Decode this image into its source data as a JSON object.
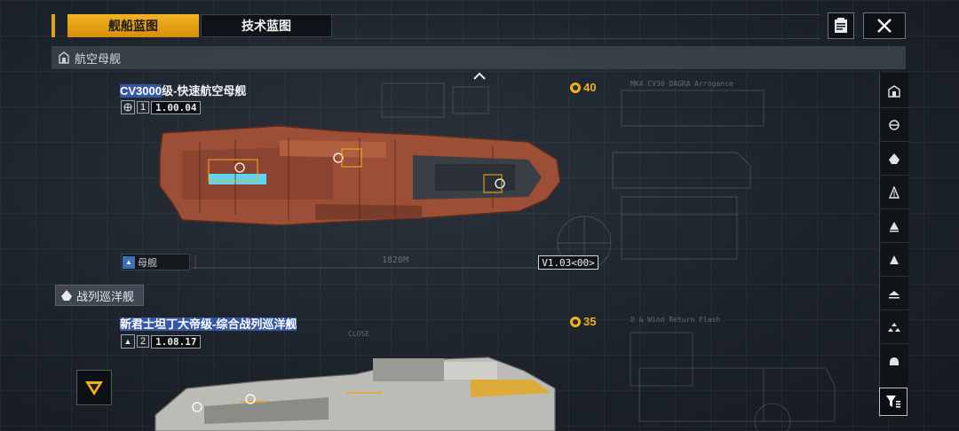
{
  "tabs": [
    {
      "label": "舰船蓝图",
      "active": true
    },
    {
      "label": "技术蓝图",
      "active": false
    }
  ],
  "category_header": "航空母舰",
  "ships": [
    {
      "name_prefix": "CV3000",
      "name_suffix": "级-快速航空母舰",
      "icon": "globe-icon",
      "tier": "1",
      "code": "1.00.04",
      "cost": "40",
      "type_label": "母舰",
      "version": "V1.03<00>",
      "length_label": "1820M",
      "hull_color": "#a8543a"
    },
    {
      "name_prefix": "新君士坦丁大帝级-综合战列巡洋舰",
      "tier": "2",
      "code": "1.08.17",
      "cost": "35",
      "hull_color": "#c9c9c4"
    }
  ],
  "section_header": "战列巡洋舰",
  "blueprint_labels": {
    "upper_right": "MK4 CV30 DAGRA Arrogance",
    "lower_right": "D & Wind Return Flash",
    "close": "CLOSE"
  },
  "sidebar_icons": [
    "carrier-icon",
    "cruiser-icon",
    "battlecruiser-icon",
    "destroyer-icon",
    "frigate-icon",
    "corvette-icon",
    "aircraft-icon",
    "fleet-icon",
    "dome-icon"
  ],
  "colors": {
    "accent": "#f2b01d",
    "highlight": "#3656a6"
  }
}
